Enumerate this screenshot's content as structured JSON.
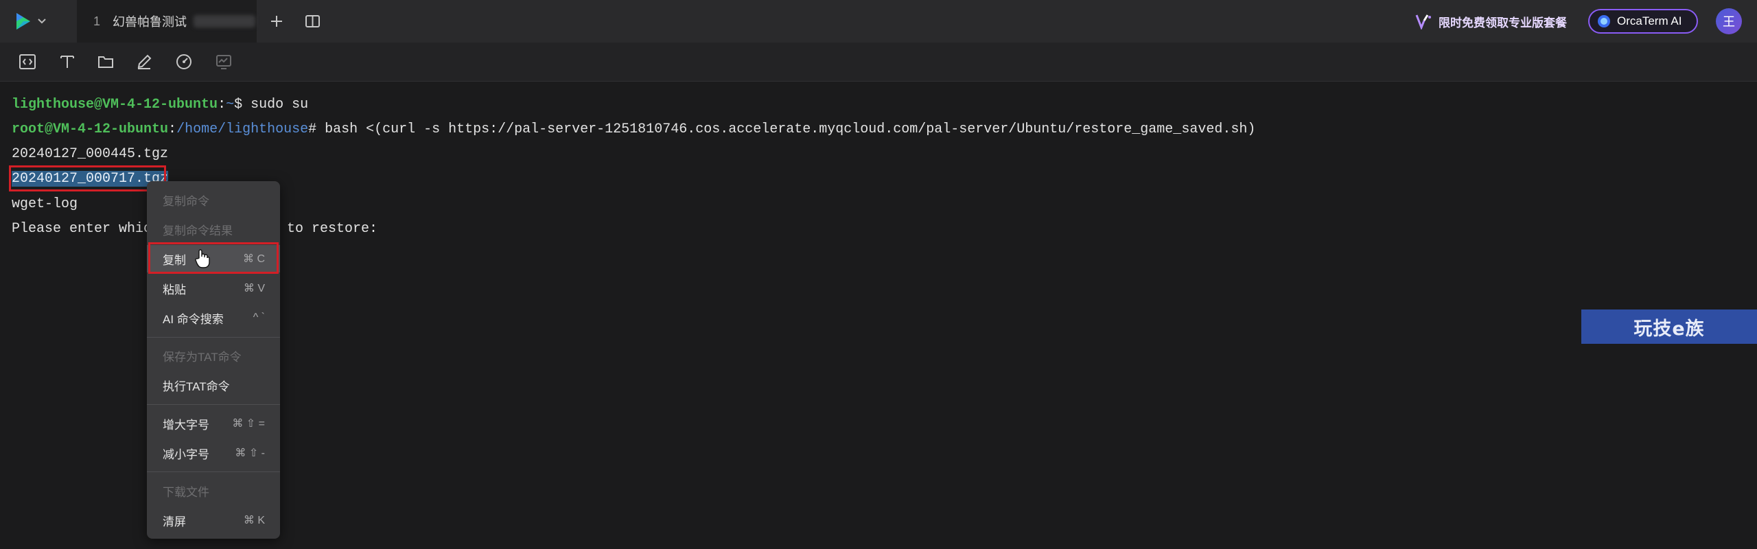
{
  "tabbar": {
    "tab": {
      "number": "1",
      "title": "幻兽帕鲁测试"
    },
    "promo_text": "限时免费领取专业版套餐",
    "orca_label": "OrcaTerm AI",
    "avatar_initial": "王"
  },
  "toolbar": {
    "icons": [
      "code-icon",
      "text-icon",
      "folder-icon",
      "edit-icon",
      "gauge-icon",
      "monitor-icon"
    ]
  },
  "terminal": {
    "line1": {
      "user": "lighthouse@VM-4-12-ubuntu",
      "sep": ":",
      "path": "~",
      "prompt": "$ ",
      "cmd": "sudo su"
    },
    "line2": {
      "user": "root@VM-4-12-ubuntu",
      "sep": ":",
      "path": "/home/lighthouse",
      "prompt": "# ",
      "cmd": "bash <(curl -s https://pal-server-1251810746.cos.accelerate.myqcloud.com/pal-server/Ubuntu/restore_game_saved.sh)"
    },
    "line3": "20240127_000445.tgz",
    "line4": "20240127_000717.tgz",
    "line5": "wget-log",
    "line6_start": "Please enter which",
    "line6_end": "to restore:"
  },
  "context_menu": {
    "items": [
      {
        "label": "复制命令",
        "shortcut": "",
        "enabled": false
      },
      {
        "label": "复制命令结果",
        "shortcut": "",
        "enabled": false
      },
      {
        "label": "复制",
        "shortcut": "⌘ C",
        "enabled": true
      },
      {
        "label": "粘贴",
        "shortcut": "⌘ V",
        "enabled": true
      },
      {
        "label": "AI 命令搜索",
        "shortcut": "^ `",
        "enabled": true
      },
      {
        "label": "保存为TAT命令",
        "shortcut": "",
        "enabled": false
      },
      {
        "label": "执行TAT命令",
        "shortcut": "",
        "enabled": true
      },
      {
        "label": "增大字号",
        "shortcut": "⌘ ⇧ =",
        "enabled": true
      },
      {
        "label": "减小字号",
        "shortcut": "⌘ ⇧ -",
        "enabled": true
      },
      {
        "label": "下载文件",
        "shortcut": "",
        "enabled": false
      },
      {
        "label": "清屏",
        "shortcut": "⌘ K",
        "enabled": true
      }
    ]
  },
  "watermark": {
    "text": "玩技e族"
  },
  "colors": {
    "accent_purple": "#8a5cf5",
    "highlight_red": "#d31f26",
    "prompt_green": "#4fbf5a",
    "path_blue": "#5a8fd8"
  }
}
